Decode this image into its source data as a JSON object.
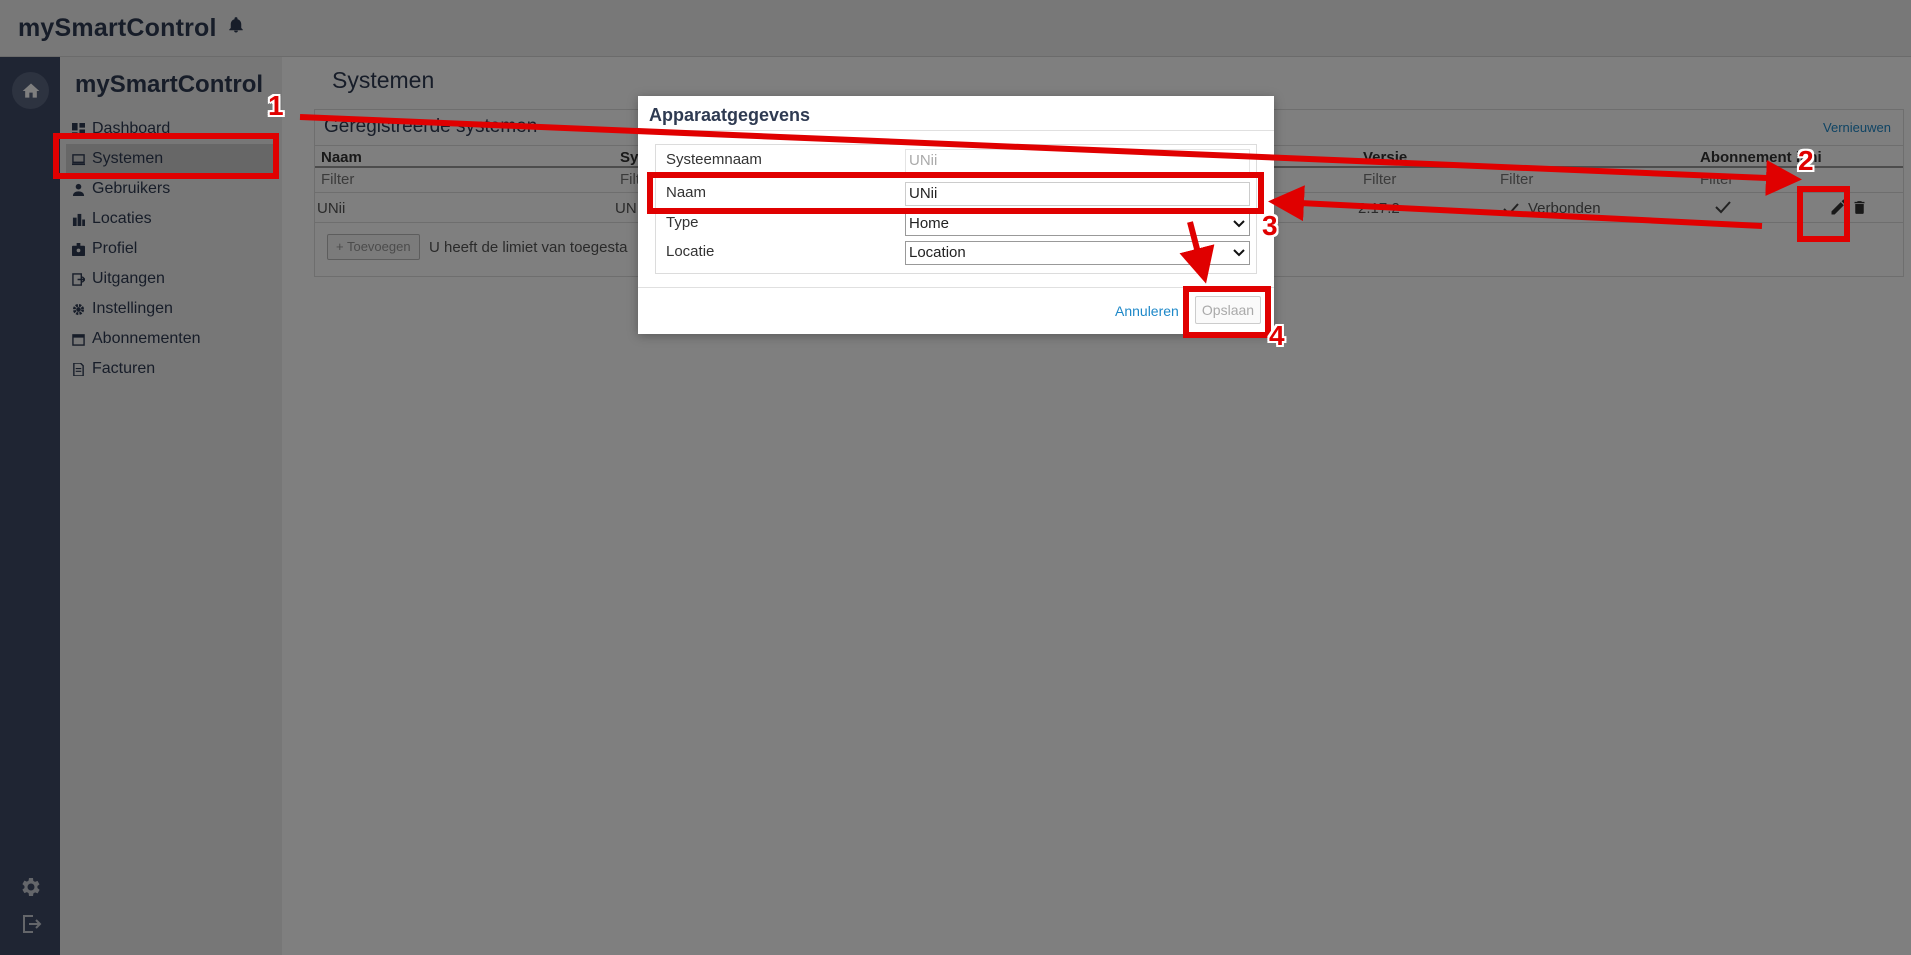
{
  "app": {
    "brand": "mySmartControl"
  },
  "sidenav": {
    "title": "mySmartControl",
    "items": [
      {
        "label": "Dashboard",
        "icon": "dashboard-icon"
      },
      {
        "label": "Systemen",
        "icon": "system-icon",
        "active": true
      },
      {
        "label": "Gebruikers",
        "icon": "user-icon"
      },
      {
        "label": "Locaties",
        "icon": "building-icon"
      },
      {
        "label": "Profiel",
        "icon": "profile-icon"
      },
      {
        "label": "Uitgangen",
        "icon": "output-icon"
      },
      {
        "label": "Instellingen",
        "icon": "gear-icon"
      },
      {
        "label": "Abonnementen",
        "icon": "calendar-icon"
      },
      {
        "label": "Facturen",
        "icon": "document-icon"
      }
    ]
  },
  "main": {
    "title": "Systemen",
    "panel": {
      "title": "Geregistreerde systemen",
      "refresh_label": "Vernieuwen",
      "columns": [
        "Naam",
        "Sys",
        "Versie",
        "Abonnement limi"
      ],
      "filter_placeholder": "Filter",
      "row": {
        "naam": "UNii",
        "systeem": "UN",
        "versie": "2.17.2",
        "status": "Verbonden"
      },
      "add_label": "+ Toevoegen",
      "limit_text": "U heeft de limiet van toegesta"
    }
  },
  "modal": {
    "title": "Apparaatgegevens",
    "fields": {
      "systeemnaam": {
        "label": "Systeemnaam",
        "value": "UNii"
      },
      "naam": {
        "label": "Naam",
        "value": "UNii"
      },
      "type": {
        "label": "Type",
        "value": "Home"
      },
      "locatie": {
        "label": "Locatie",
        "value": "Location"
      }
    },
    "cancel_label": "Annuleren",
    "save_label": "Opslaan"
  },
  "annotations": [
    "1",
    "2",
    "3",
    "4"
  ],
  "colors": {
    "annotation": "#e00000",
    "rail": "#3e4a66",
    "link": "#1e88c8"
  }
}
